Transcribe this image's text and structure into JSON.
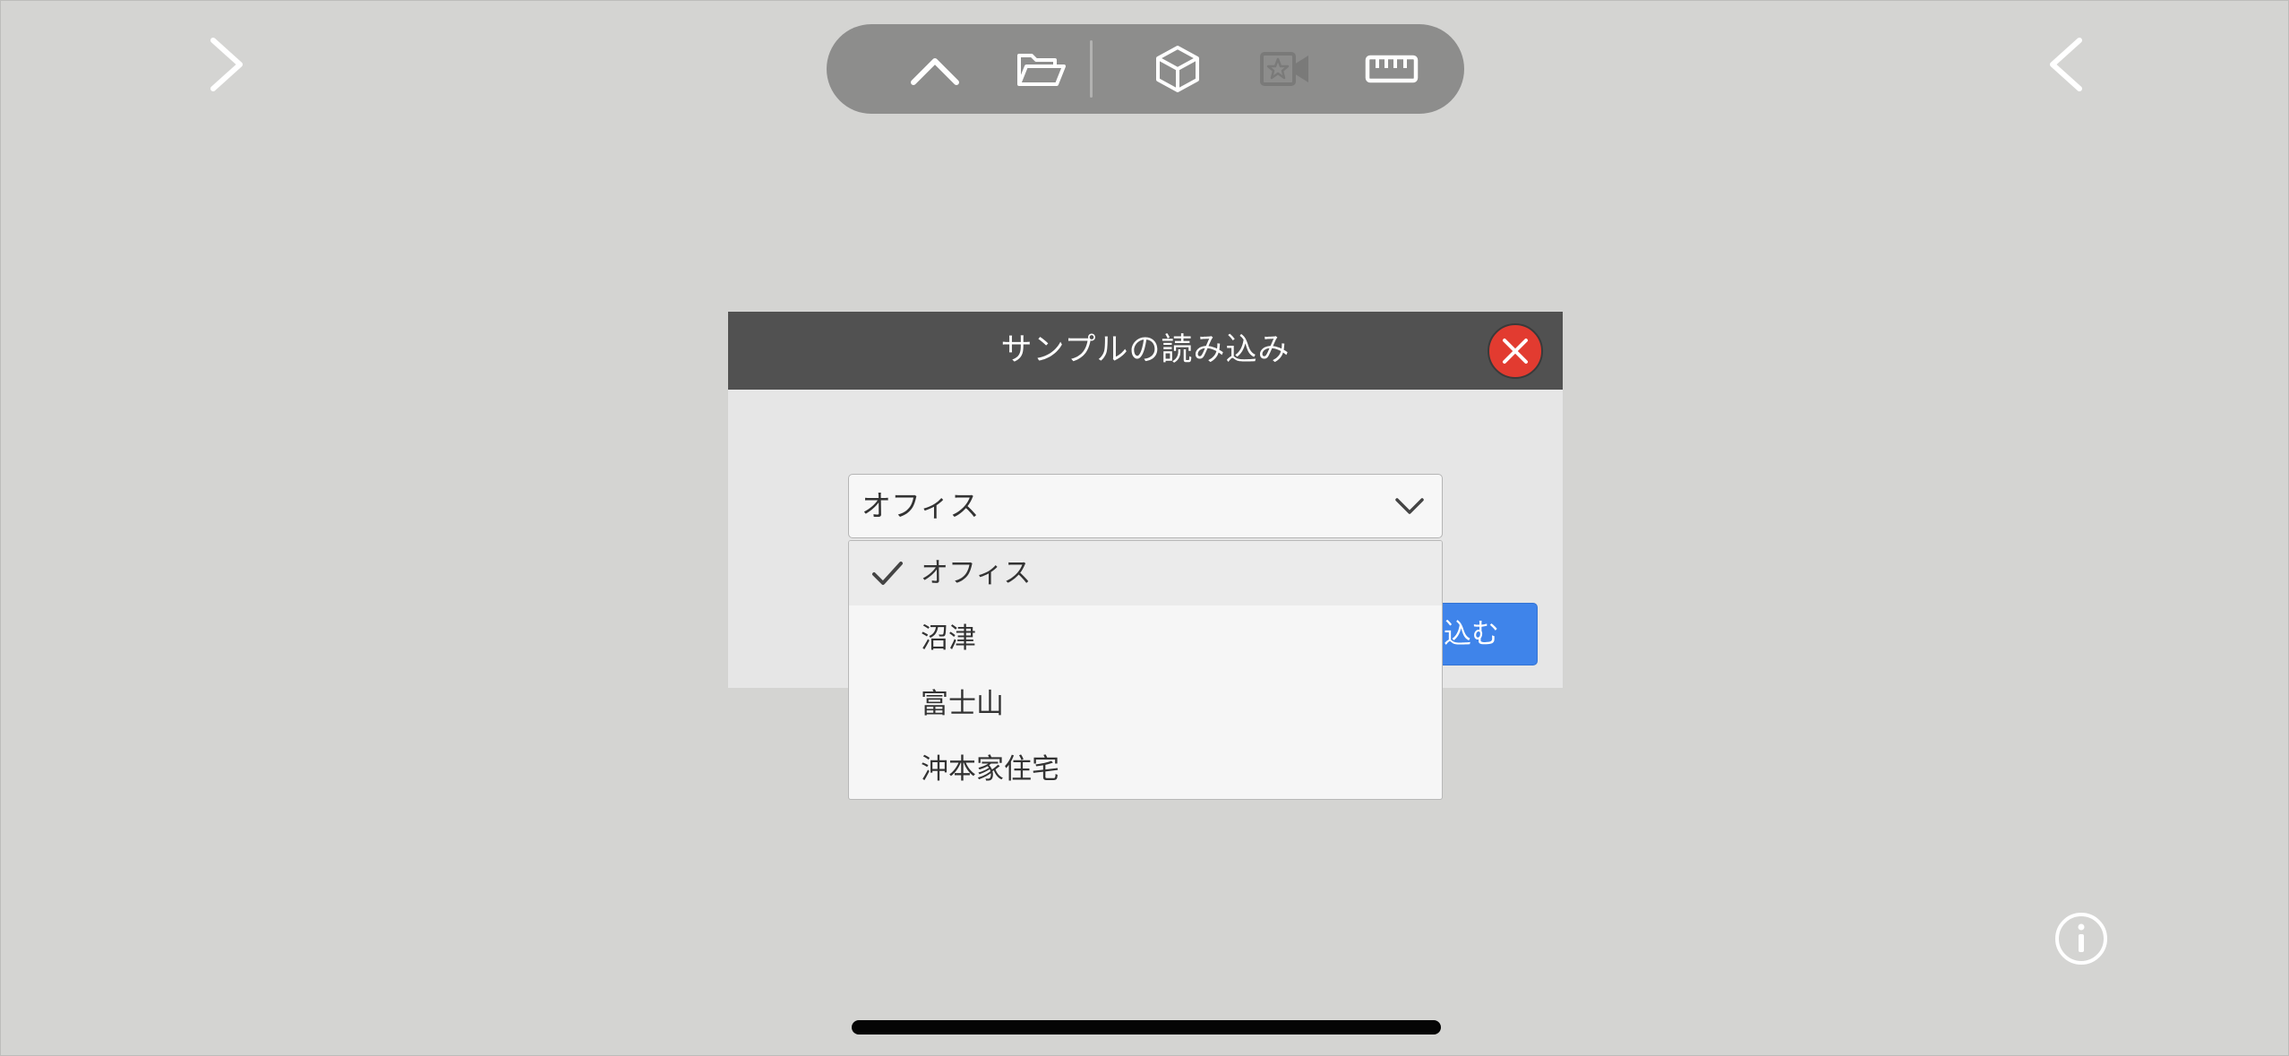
{
  "toolbar": {
    "buttons": [
      {
        "icon": "chevron-up-icon",
        "enabled": true
      },
      {
        "icon": "folder-open-icon",
        "enabled": true
      },
      {
        "icon": "cube-icon",
        "enabled": true
      },
      {
        "icon": "camera-star-icon",
        "enabled": false
      },
      {
        "icon": "ruler-icon",
        "enabled": true
      }
    ]
  },
  "nav": {
    "left_icon": "chevron-right-icon",
    "right_icon": "chevron-left-icon"
  },
  "dialog": {
    "title": "サンプルの読み込み",
    "close_icon": "close-icon",
    "select": {
      "value": "オフィス",
      "options": [
        "オフィス",
        "沼津",
        "富士山",
        "沖本家住宅"
      ],
      "selected_index": 0
    },
    "load_button_visible_label": "込む"
  },
  "colors": {
    "background": "#d4d4d2",
    "header": "#515151",
    "close": "#e23b30",
    "primary": "#3f84ea",
    "toolbar": "#8d8d8c"
  },
  "info_icon": "info-icon"
}
